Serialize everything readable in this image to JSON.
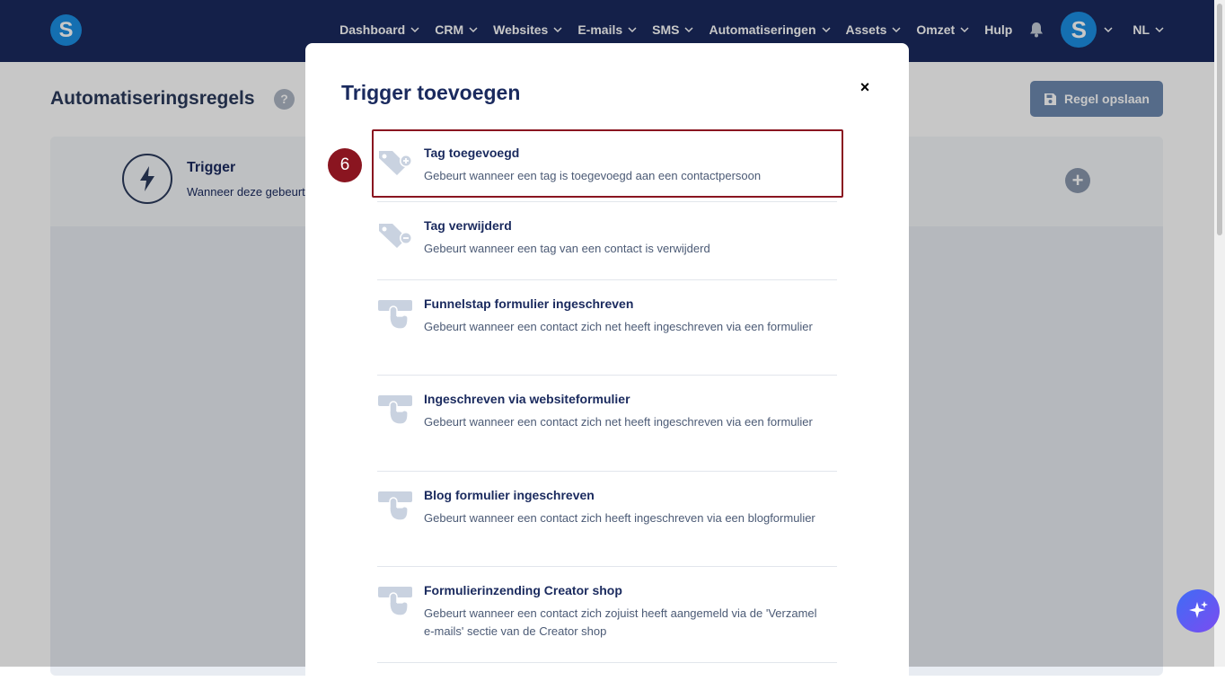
{
  "header": {
    "logo_letter": "S",
    "nav": [
      {
        "label": "Dashboard",
        "dropdown": true
      },
      {
        "label": "CRM",
        "dropdown": true
      },
      {
        "label": "Websites",
        "dropdown": true
      },
      {
        "label": "E-mails",
        "dropdown": true
      },
      {
        "label": "SMS",
        "dropdown": true
      },
      {
        "label": "Automatiseringen",
        "dropdown": true
      },
      {
        "label": "Assets",
        "dropdown": true
      },
      {
        "label": "Omzet",
        "dropdown": true
      },
      {
        "label": "Hulp",
        "dropdown": false
      }
    ],
    "avatar_letter": "S",
    "language": "NL"
  },
  "page": {
    "title": "Automatiseringsregels",
    "help_label": "?",
    "save_button": "Regel opslaan",
    "trigger_card": {
      "title": "Trigger",
      "subtitle": "Wanneer deze gebeurtenis"
    }
  },
  "modal": {
    "title": "Trigger toevoegen",
    "close_label": "×",
    "triggers": [
      {
        "title": "Tag toegevoegd",
        "desc": "Gebeurt wanneer een tag is toegevoegd aan een contactpersoon",
        "icon": "tag-plus-icon"
      },
      {
        "title": "Tag verwijderd",
        "desc": "Gebeurt wanneer een tag van een contact is verwijderd",
        "icon": "tag-minus-icon"
      },
      {
        "title": "Funnelstap formulier ingeschreven",
        "desc": "Gebeurt wanneer een contact zich net heeft ingeschreven via een formulier",
        "icon": "form-click-icon"
      },
      {
        "title": "Ingeschreven via websiteformulier",
        "desc": "Gebeurt wanneer een contact zich net heeft ingeschreven via een formulier",
        "icon": "form-click-icon"
      },
      {
        "title": "Blog formulier ingeschreven",
        "desc": "Gebeurt wanneer een contact zich heeft ingeschreven via een blogformulier",
        "icon": "form-click-icon"
      },
      {
        "title": "Formulierinzending Creator shop",
        "desc": "Gebeurt wanneer een contact zich zojuist heeft aangemeld via de 'Verzamel e-mails' sectie van de Creator shop",
        "icon": "form-click-icon"
      }
    ]
  },
  "annotation": {
    "step_number": "6"
  },
  "colors": {
    "topbar": "#1a2a5e",
    "brand_blue": "#1b8fe3",
    "highlight": "#8a1520"
  }
}
